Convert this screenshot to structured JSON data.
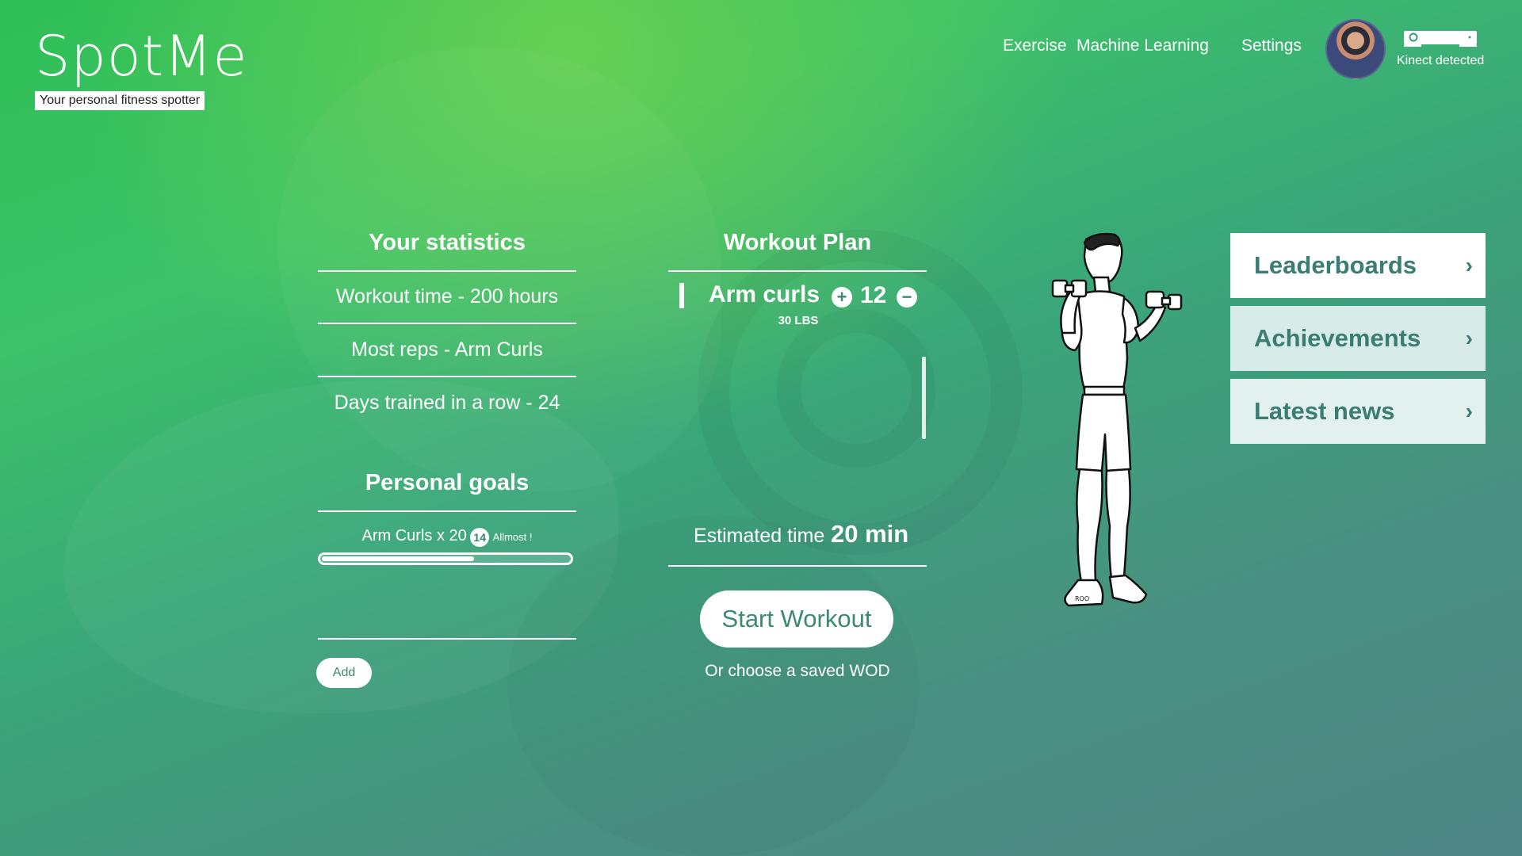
{
  "brand": {
    "name": "SpotMe",
    "tagline": "Your personal fitness spotter"
  },
  "nav": {
    "links": [
      "Exercise",
      "Machine Learning",
      "Settings"
    ],
    "kinect_status": "Kinect detected"
  },
  "statistics": {
    "title": "Your statistics",
    "items": [
      "Workout time - 200 hours",
      "Most reps - Arm Curls",
      "Days trained in a row - 24"
    ]
  },
  "goals": {
    "title": "Personal goals",
    "items": [
      {
        "label": "Arm Curls x 20",
        "badge": "14",
        "status": "Allmost !",
        "progress": 0.62
      }
    ],
    "add_label": "Add"
  },
  "plan": {
    "title": "Workout Plan",
    "exercises": [
      {
        "name": "Arm curls",
        "weight": "30 LBS",
        "reps": "12"
      }
    ],
    "estimated_label": "Estimated time",
    "estimated_value": "20 min",
    "start_label": "Start Workout",
    "wod_prefix": "Or choose a",
    "wod_link": "saved WOD"
  },
  "tiles": [
    {
      "label": "Leaderboards",
      "bg": "#ffffff"
    },
    {
      "label": "Achievements",
      "bg": "#d7ece8"
    },
    {
      "label": "Latest news",
      "bg": "#e3f1ee"
    }
  ],
  "icons": {
    "plus": "plus-circle-icon",
    "minus": "minus-circle-icon",
    "chevron": "chevron-right-icon",
    "kinect": "kinect-sensor-icon"
  }
}
